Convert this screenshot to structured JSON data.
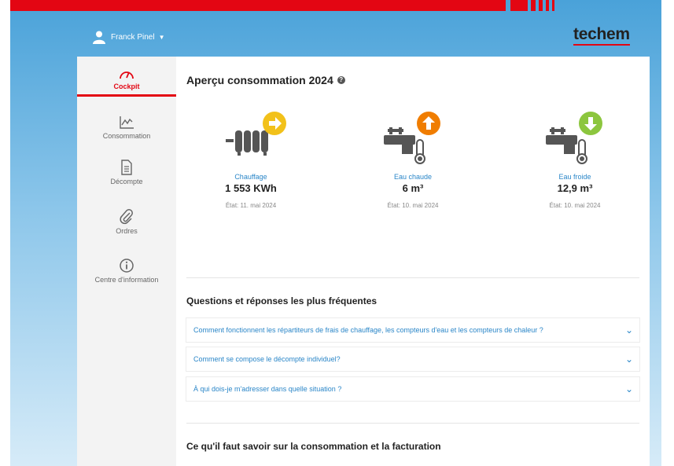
{
  "header": {
    "user_name": "Franck Pinel",
    "logo_text": "techem"
  },
  "sidebar": {
    "items": [
      {
        "label": "Cockpit",
        "icon": "gauge-icon",
        "active": true
      },
      {
        "label": "Consommation",
        "icon": "line-chart-icon",
        "active": false
      },
      {
        "label": "Décompte",
        "icon": "document-icon",
        "active": false
      },
      {
        "label": "Ordres",
        "icon": "paperclip-icon",
        "active": false
      },
      {
        "label": "Centre d'information",
        "icon": "info-icon",
        "active": false
      }
    ]
  },
  "overview": {
    "title": "Aperçu consommation 2024",
    "cards": [
      {
        "label": "Chauffage",
        "value": "1  553 KWh",
        "date": "État: 11. mai 2024",
        "trend": "right",
        "trend_color": "#f2c11a",
        "icon": "radiator-icon"
      },
      {
        "label": "Eau chaude",
        "value": "6 m³",
        "date": "État: 10. mai 2024",
        "trend": "up",
        "trend_color": "#f07d00",
        "icon": "hot-water-tap-icon"
      },
      {
        "label": "Eau froide",
        "value": "12,9 m³",
        "date": "État: 10. mai 2024",
        "trend": "down",
        "trend_color": "#8cc63e",
        "icon": "cold-water-tap-icon"
      }
    ]
  },
  "faq": {
    "title": "Questions et réponses les plus fréquentes",
    "items": [
      "Comment fonctionnent les répartiteurs de frais de chauffage, les compteurs d'eau et les compteurs de chaleur ?",
      "Comment se compose le décompte individuel?",
      "À qui dois-je m'adresser dans quelle situation ?"
    ]
  },
  "billing": {
    "title": "Ce qu'il faut savoir sur la consommation et la facturation"
  },
  "colors": {
    "brand_red": "#e30613",
    "link_blue": "#2a86c8",
    "sky": "#4aa2d9"
  }
}
